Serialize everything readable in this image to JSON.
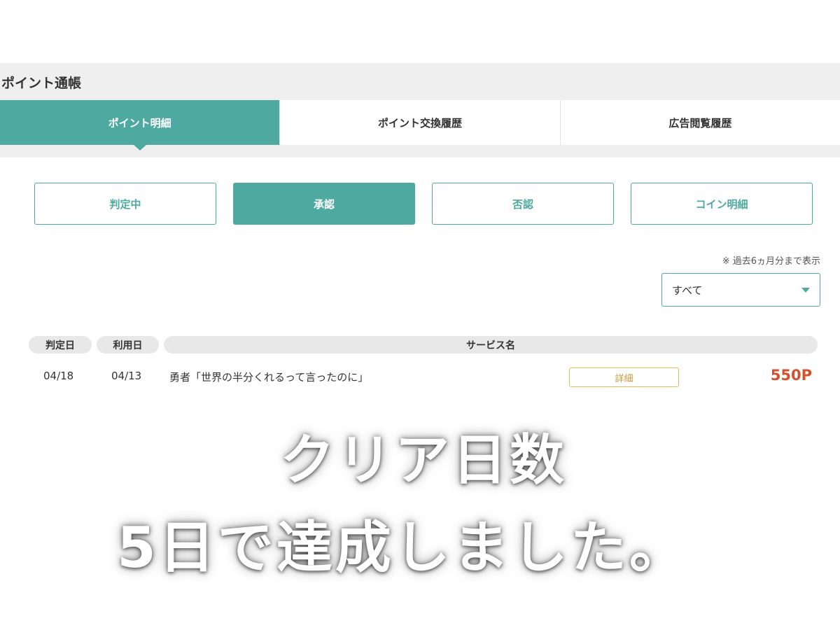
{
  "page": {
    "title": "ポイント通帳"
  },
  "tabs": [
    {
      "label": "ポイント明細",
      "active": true
    },
    {
      "label": "ポイント交換履歴",
      "active": false
    },
    {
      "label": "広告閲覧履歴",
      "active": false
    }
  ],
  "filters": [
    {
      "label": "判定中",
      "active": false
    },
    {
      "label": "承認",
      "active": true
    },
    {
      "label": "否認",
      "active": false
    },
    {
      "label": "コイン明細",
      "active": false
    }
  ],
  "note": "※ 過去6ヵ月分まで表示",
  "select": {
    "value": "すべて"
  },
  "table": {
    "headers": [
      "判定日",
      "利用日",
      "サービス名"
    ],
    "rows": [
      {
        "judged": "04/18",
        "used": "04/13",
        "service": "勇者「世界の半分くれるって言ったのに」",
        "detail": "詳細",
        "points": "550P"
      }
    ]
  },
  "caption": {
    "line1": "クリア日数",
    "line2": "5日で達成しました。"
  },
  "colors": {
    "accent": "#4ea9a0",
    "points": "#d2532b",
    "detail": "#e8b95a"
  }
}
